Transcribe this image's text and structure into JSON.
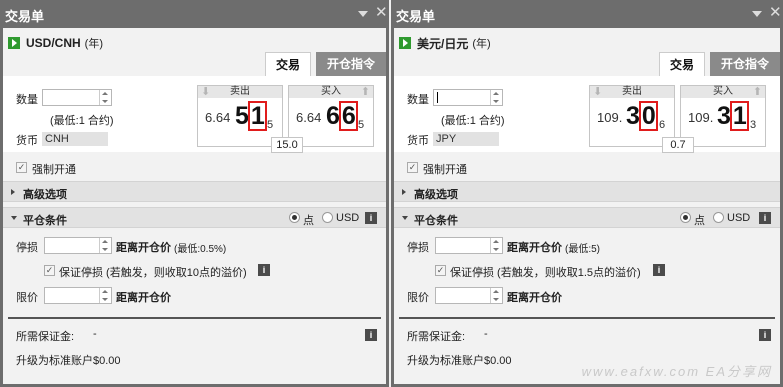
{
  "panels": [
    {
      "title": "交易单",
      "instrument": "USD/CNH",
      "instrument_sub": "(年)",
      "tabs": {
        "trade": "交易",
        "open_order": "开仓指令"
      },
      "quantity_label": "数量",
      "quantity_value": "",
      "min_contract": "(最低:1 合约)",
      "currency_label": "货币",
      "currency_value": "CNH",
      "sell": {
        "label": "卖出",
        "prefix": "6.64",
        "big_plain": "5",
        "big_highlight": "1",
        "tail": "5"
      },
      "buy": {
        "label": "买入",
        "prefix": "6.64",
        "big_plain": "6",
        "big_highlight": "6",
        "tail": "5"
      },
      "spread": "15.0",
      "force_open": "强制开通",
      "advanced": "高级选项",
      "close_conditions": "平仓条件",
      "radio_points": "点",
      "radio_usd": "USD",
      "stop_loss": "停损",
      "stop_distance": "距离开仓价",
      "stop_min": "(最低:0.5%)",
      "guaranteed_stop": "保证停损 (若触发，则收取10点的溢价)",
      "limit": "限价",
      "limit_distance": "距离开仓价",
      "margin_label": "所需保证金:",
      "margin_value": "-",
      "upgrade": "升级为标准账户$0.00"
    },
    {
      "title": "交易单",
      "instrument": "美元/日元",
      "instrument_sub": "(年)",
      "tabs": {
        "trade": "交易",
        "open_order": "开仓指令"
      },
      "quantity_label": "数量",
      "quantity_value": "",
      "min_contract": "(最低:1 合约)",
      "currency_label": "货币",
      "currency_value": "JPY",
      "sell": {
        "label": "卖出",
        "prefix": "109.",
        "big_plain": "3",
        "big_highlight": "0",
        "tail": "6"
      },
      "buy": {
        "label": "买入",
        "prefix": "109.",
        "big_plain": "3",
        "big_highlight": "1",
        "tail": "3"
      },
      "spread": "0.7",
      "force_open": "强制开通",
      "advanced": "高级选项",
      "close_conditions": "平仓条件",
      "radio_points": "点",
      "radio_usd": "USD",
      "stop_loss": "停损",
      "stop_distance": "距离开仓价",
      "stop_min": "(最低:5)",
      "guaranteed_stop": "保证停损 (若触发，则收取1.5点的溢价)",
      "limit": "限价",
      "limit_distance": "距离开仓价",
      "margin_label": "所需保证金:",
      "margin_value": "-",
      "upgrade": "升级为标准账户$0.00"
    }
  ],
  "watermark": "www.eafxw.com EA分享网",
  "colors": {
    "play_icon": "#2f9a2f",
    "highlight_box": "#e01c1c",
    "titlebar": "#6d6d6d"
  }
}
